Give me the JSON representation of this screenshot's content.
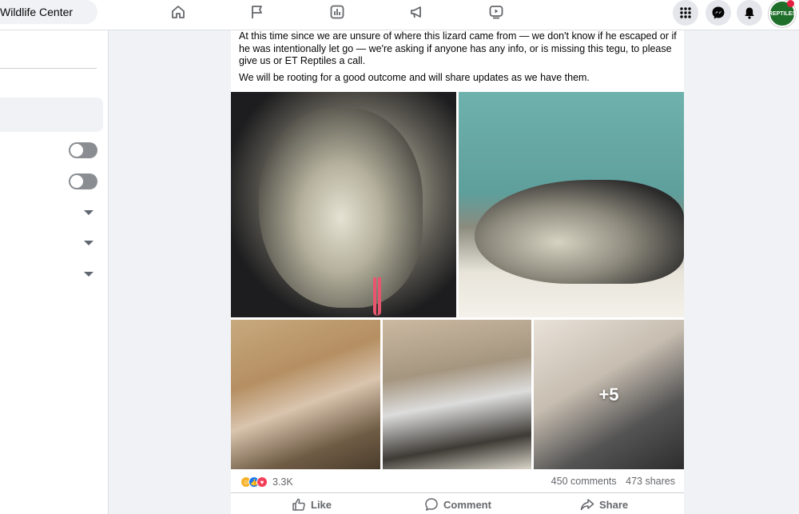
{
  "header": {
    "page_name": "Wildlife Center",
    "nav_icons": [
      "home-icon",
      "flag-icon",
      "analytics-icon",
      "megaphone-icon",
      "video-icon"
    ],
    "right_icons": [
      "grid-menu-icon",
      "messenger-icon",
      "bell-icon"
    ],
    "avatar_text": "REPTILES"
  },
  "sidebar": {
    "toggles": [
      {
        "state": "off"
      },
      {
        "state": "off"
      }
    ],
    "dropdowns": 3
  },
  "post": {
    "paragraphs": [
      "At this time since we are unsure of where this lizard came from — we don't know if he escaped or if he was intentionally let go —  we're asking if anyone has any info, or is missing this tegu, to please give us or ET Reptiles a call.",
      "We will be rooting for a good outcome and will share updates as we have them."
    ],
    "photos": {
      "more_count": "+5"
    },
    "reaction_count": "3.3K",
    "comments": "450 comments",
    "shares": "473 shares",
    "actions": {
      "like": "Like",
      "comment": "Comment",
      "share": "Share"
    }
  },
  "colors": {
    "accent": "#1877f2",
    "background": "#f0f2f5",
    "secondary_text": "#65676b"
  }
}
